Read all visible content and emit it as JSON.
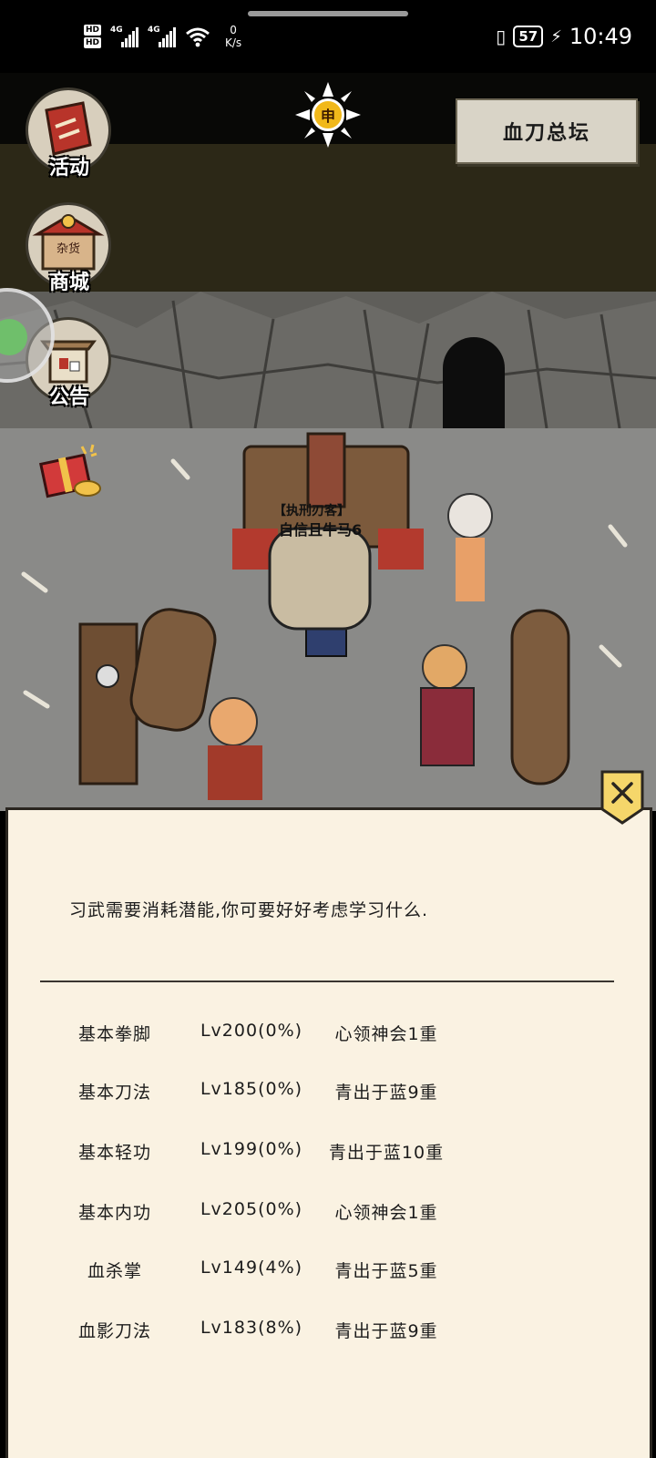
{
  "status_bar": {
    "hd_top": "HD",
    "hd_bottom": "HD",
    "network_1": "4G",
    "network_2": "4G",
    "speed_value": "0",
    "speed_unit": "K/s",
    "battery": "57",
    "time": "10:49"
  },
  "map": {
    "title": "血刀总坛",
    "time_symbol": "申"
  },
  "menu": {
    "activity_label": "活动",
    "shop_label": "商城",
    "shop_sign": "杂货",
    "notice_label": "公告"
  },
  "npc": {
    "title": "【执刑刃客】",
    "name": "自信且牛马6"
  },
  "dialog": {
    "intro": "习武需要消耗潜能,你可要好好考虑学习什么.",
    "skills": [
      {
        "name": "基本拳脚",
        "level": "Lv200(0%)",
        "rank": "心领神会1重"
      },
      {
        "name": "基本刀法",
        "level": "Lv185(0%)",
        "rank": "青出于蓝9重"
      },
      {
        "name": "基本轻功",
        "level": "Lv199(0%)",
        "rank": "青出于蓝10重"
      },
      {
        "name": "基本内功",
        "level": "Lv205(0%)",
        "rank": "心领神会1重"
      },
      {
        "name": "血杀掌",
        "level": "Lv149(4%)",
        "rank": "青出于蓝5重"
      },
      {
        "name": "血影刀法",
        "level": "Lv183(8%)",
        "rank": "青出于蓝9重"
      }
    ]
  },
  "colors": {
    "panel_bg": "#faf2e2",
    "map_title_bg": "#d9d4c7",
    "sun": "#f1b81a"
  }
}
